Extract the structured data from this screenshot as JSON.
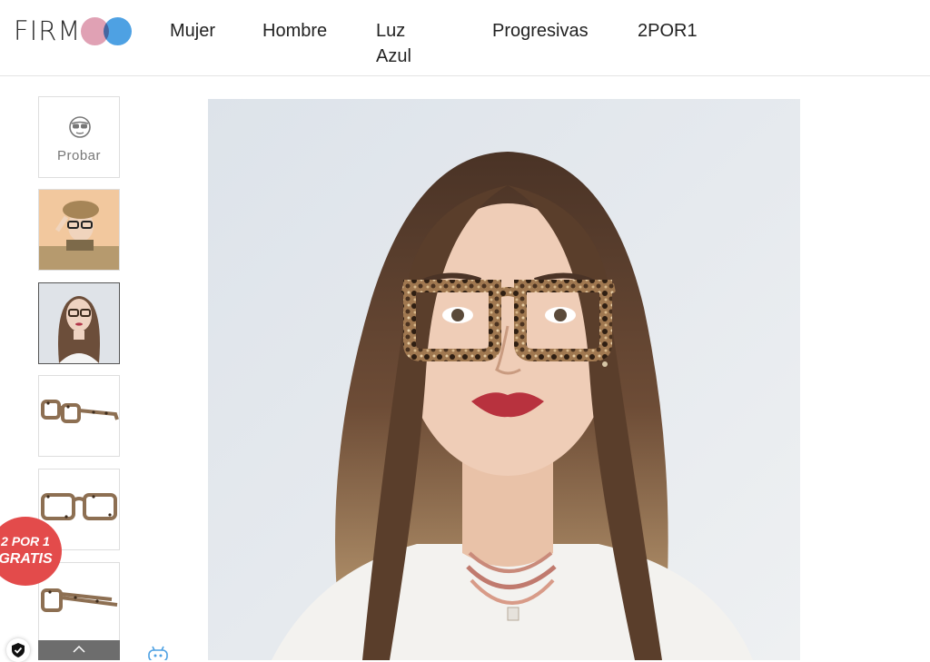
{
  "brand": {
    "name": "FIRM",
    "dot_colors": [
      "#e0a1b4",
      "#4ea1e3"
    ]
  },
  "nav": {
    "items": [
      {
        "label": "Mujer"
      },
      {
        "label": "Hombre"
      },
      {
        "label": "Luz Azul"
      },
      {
        "label": "Progresivas"
      },
      {
        "label": "2POR1"
      }
    ]
  },
  "gallery": {
    "try_on_label": "Probar",
    "thumbnails": [
      {
        "icon": "try-on-icon",
        "label": "Probar"
      },
      {
        "icon": "model-hat-photo"
      },
      {
        "icon": "model-portrait-photo",
        "selected": true
      },
      {
        "icon": "glasses-side-view"
      },
      {
        "icon": "glasses-front-view"
      },
      {
        "icon": "glasses-angle-view"
      }
    ]
  },
  "promo": {
    "line1": "2 POR 1",
    "line2": "GRATIS",
    "color": "#e34b4b"
  },
  "icons": {
    "scroll_up": "chevron-up-icon",
    "trust": "shield-check-icon",
    "assistant": "robot-icon"
  }
}
